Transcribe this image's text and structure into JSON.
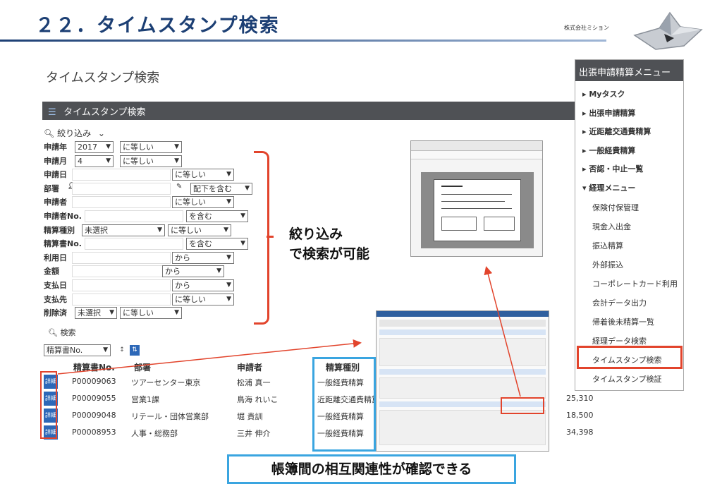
{
  "slide": {
    "title": "２２．タイムスタンプ検索",
    "company": "株式会社ミション"
  },
  "screen": {
    "page_title": "タイムスタンプ検索",
    "panel_title": "タイムスタンプ検索",
    "filter_toggle": "絞り込み",
    "search_button": "検索",
    "fields": [
      {
        "label": "申請年",
        "value": "2017",
        "op": "に等しい"
      },
      {
        "label": "申請月",
        "value": "4",
        "op": "に等しい"
      },
      {
        "label": "申請日",
        "op": "に等しい"
      },
      {
        "label": "部署",
        "op": "配下を含む"
      },
      {
        "label": "申請者",
        "op": "に等しい"
      },
      {
        "label": "申請者No.",
        "op": "を含む"
      },
      {
        "label": "精算種別",
        "value": "未選択",
        "op": "に等しい"
      },
      {
        "label": "精算書No.",
        "op": "を含む"
      },
      {
        "label": "利用日",
        "op": "から"
      },
      {
        "label": "金額",
        "op": "から"
      },
      {
        "label": "支払日",
        "op": "から"
      },
      {
        "label": "支払先",
        "op": "に等しい"
      },
      {
        "label": "削除済",
        "value": "未選択",
        "op": "に等しい"
      }
    ],
    "sort_select": "精算書No.",
    "table": {
      "headers": [
        "精算書No.",
        "部署",
        "申請者",
        "精算種別"
      ],
      "detail_label": "詳細",
      "rows": [
        {
          "no": "P00009063",
          "dept": "ツアーセンター東京",
          "applicant": "松浦 真一",
          "type": "一般経費精算",
          "amount": ""
        },
        {
          "no": "P00009055",
          "dept": "営業1課",
          "applicant": "鳥海 れいこ",
          "type": "近距離交通費精算",
          "amount": "25,310"
        },
        {
          "no": "P00009048",
          "dept": "リテール・団体営業部",
          "applicant": "堀 貴訓",
          "type": "一般経費精算",
          "amount": "18,500"
        },
        {
          "no": "P00008953",
          "dept": "人事・総務部",
          "applicant": "三井 伸介",
          "type": "一般経費精算",
          "amount": "34,398"
        }
      ]
    }
  },
  "menu": {
    "title": "出張申請精算メニュー",
    "items": [
      "Myタスク",
      "出張申請精算",
      "近距離交通費精算",
      "一般経費精算",
      "否認・中止一覧",
      "経理メニュー"
    ],
    "sub_items": [
      "保険付保管理",
      "現金入出金",
      "振込精算",
      "外部振込",
      "コーポレートカード利用",
      "会計データ出力",
      "帰着後未精算一覧",
      "経理データ検索",
      "タイムスタンプ検索",
      "タイムスタンプ検証"
    ]
  },
  "callouts": {
    "filter_line1": "絞り込み",
    "filter_line2": "で検索が可能",
    "ledger": "帳簿間の相互関連性が確認できる"
  },
  "colors": {
    "title": "#1c3f74",
    "red": "#e2442c",
    "blue": "#3aa5e0",
    "bar": "#4f5155",
    "button": "#2d68b8"
  }
}
